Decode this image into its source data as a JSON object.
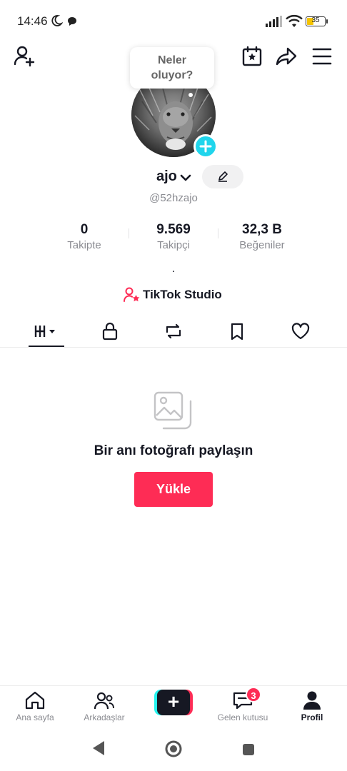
{
  "status_bar": {
    "time": "14:46",
    "battery": "35",
    "battery_level": 0.35
  },
  "top_nav": {
    "icons": [
      "add-friend-icon",
      "calendar-star-icon",
      "share-icon",
      "menu-icon"
    ]
  },
  "profile": {
    "bubble_text_line1": "Neler",
    "bubble_text_line2": "oluyor?",
    "username": "ajo",
    "handle": "@52hzajo",
    "bio": ".",
    "studio_label": "TikTok Studio",
    "stats": [
      {
        "value": "0",
        "label": "Takipte"
      },
      {
        "value": "9.569",
        "label": "Takipçi"
      },
      {
        "value": "32,3 B",
        "label": "Beğeniler"
      }
    ]
  },
  "tabs": {
    "icons": [
      "videos-grid-icon",
      "lock-icon",
      "repost-icon",
      "bookmark-icon",
      "heart-icon"
    ]
  },
  "empty_state": {
    "title": "Bir anı fotoğrafı paylaşın",
    "button_label": "Yükle"
  },
  "bottom_nav": {
    "items": [
      {
        "label": "Ana sayfa"
      },
      {
        "label": "Arkadaşlar"
      },
      {
        "label": "+"
      },
      {
        "label": "Gelen kutusu"
      },
      {
        "label": "Profil"
      }
    ],
    "inbox_badge": "3"
  },
  "colors": {
    "accent": "#fe2c55",
    "cyan": "#20d5ec",
    "text": "#161823",
    "muted": "#8a8b91"
  }
}
